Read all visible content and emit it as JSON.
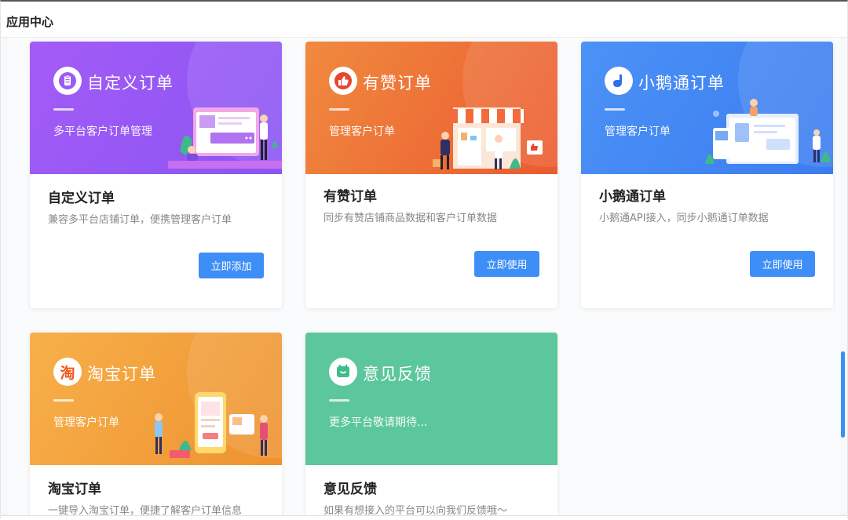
{
  "header": {
    "title": "应用中心"
  },
  "cards": [
    {
      "banner_title": "自定义订单",
      "banner_sub": "多平台客户订单管理",
      "title": "自定义订单",
      "desc": "兼容多平台店铺订单，便携管理客户订单",
      "button": "立即添加",
      "color": "#9b5cf6",
      "icon": "clipboard-icon"
    },
    {
      "banner_title": "有赞订单",
      "banner_sub": "管理客户订单",
      "title": "有赞订单",
      "desc": "同步有赞店铺商品数据和客户订单数据",
      "button": "立即使用",
      "color": "#ef6d37",
      "icon": "thumbs-up-icon"
    },
    {
      "banner_title": "小鹅通订单",
      "banner_sub": "管理客户订单",
      "title": "小鹅通订单",
      "desc": "小鹅通API接入，同步小鹅通订单数据",
      "button": "立即使用",
      "color": "#3f86f4",
      "icon": "goose-icon"
    },
    {
      "banner_title": "淘宝订单",
      "banner_sub": "管理客户订单",
      "title": "淘宝订单",
      "desc": "一键导入淘宝订单，便捷了解客户订单信息",
      "color": "#f2a33a",
      "icon": "taobao-icon",
      "logo_char": "淘"
    },
    {
      "banner_title": "意见反馈",
      "banner_sub": "更多平台敬请期待...",
      "title": "意见反馈",
      "desc": "如果有想接入的平台可以向我们反馈哦～",
      "color": "#5cc69c",
      "icon": "feedback-icon"
    }
  ]
}
